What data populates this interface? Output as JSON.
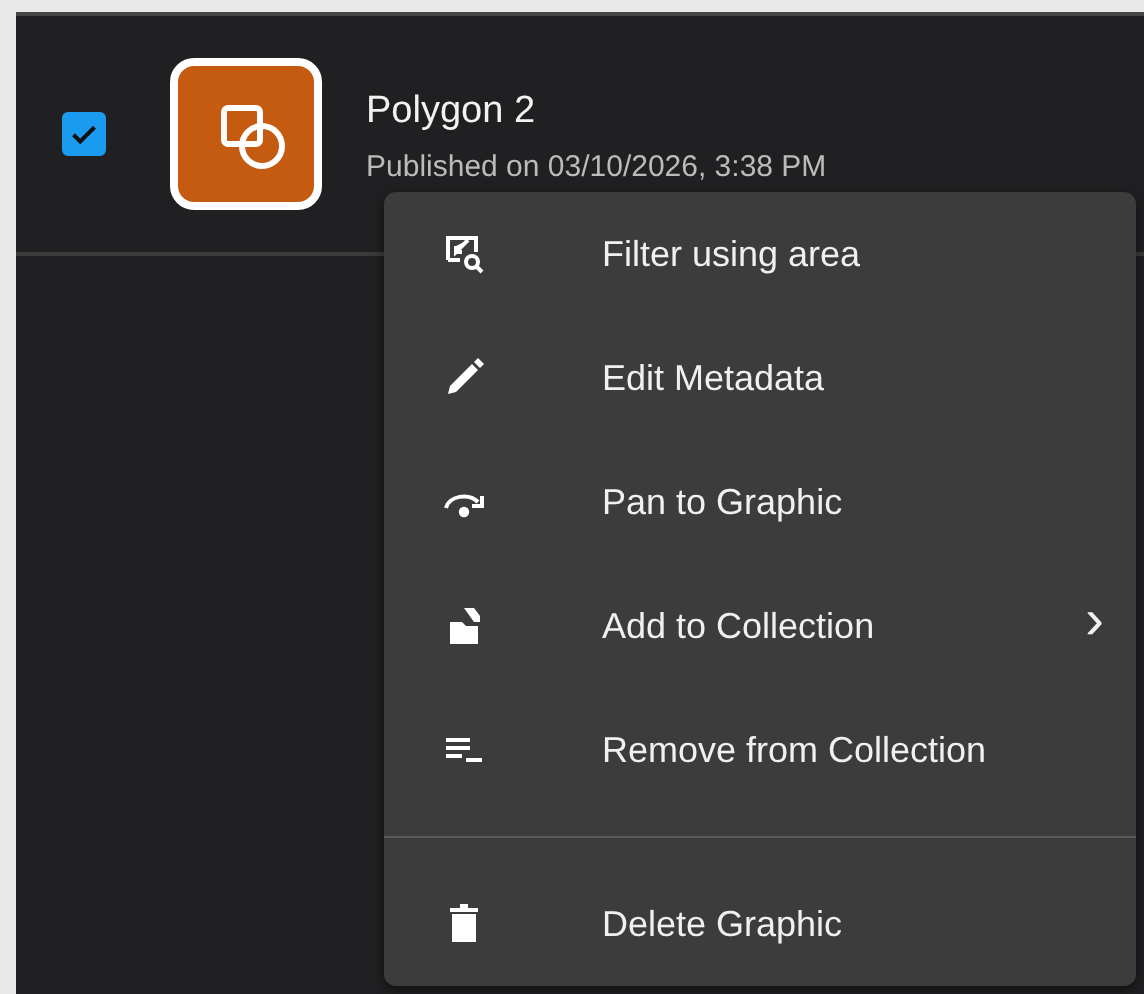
{
  "item": {
    "checked": true,
    "title": "Polygon 2",
    "subtitle": "Published on 03/10/2026, 3:38 PM"
  },
  "menu": {
    "sections": [
      [
        {
          "label": "Filter using area",
          "kind": "action"
        },
        {
          "label": "Edit Metadata",
          "kind": "action"
        },
        {
          "label": "Pan to Graphic",
          "kind": "action"
        },
        {
          "label": "Add to Collection",
          "kind": "submenu",
          "arrow": "›"
        },
        {
          "label": "Remove from Collection",
          "kind": "action"
        }
      ],
      [
        {
          "label": "Delete Graphic",
          "kind": "action"
        }
      ]
    ]
  }
}
